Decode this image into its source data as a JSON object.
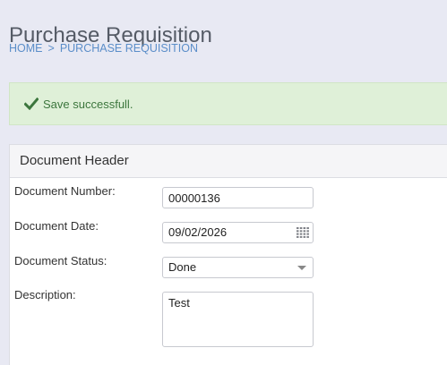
{
  "page": {
    "title": "Purchase Requisition"
  },
  "breadcrumb": {
    "home": "HOME",
    "separator": ">",
    "current": "PURCHASE REQUISITION"
  },
  "alert": {
    "icon": "check-icon",
    "message": "Save successfull.",
    "color": "#3c763d"
  },
  "document_header": {
    "title": "Document Header",
    "fields": {
      "number": {
        "label": "Document Number:",
        "value": "00000136"
      },
      "date": {
        "label": "Document Date:",
        "value": "09/02/2026",
        "icon": "calendar-icon"
      },
      "status": {
        "label": "Document Status:",
        "value": "Done"
      },
      "description": {
        "label": "Description:",
        "value": "Test"
      }
    }
  }
}
